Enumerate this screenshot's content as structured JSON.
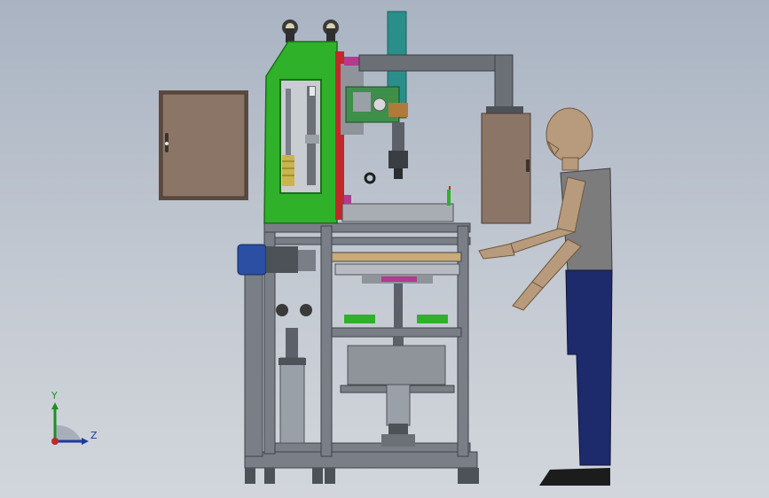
{
  "colors": {
    "background_top": "#a9b3c2",
    "background_bottom": "#d2d6dc",
    "frame_steel": "#7a7e86",
    "frame_dark": "#4d5158",
    "cabinet_panel": "#8a7566",
    "guard_green": "#2fb12a",
    "motor_blue": "#2a4fa3",
    "mannequin_skin": "#b89a7c",
    "mannequin_shirt": "#7c7c7c",
    "mannequin_pants": "#1d2a6b",
    "accent_teal": "#2a8f8a",
    "accent_red": "#c0282b"
  },
  "triad": {
    "y_label": "Y",
    "z_label": "Z",
    "y_color": "#1f8f1f",
    "z_color": "#1e3a9e",
    "origin_color": "#c0282b"
  },
  "icons": {
    "triad": "coordinate-triad-icon"
  }
}
